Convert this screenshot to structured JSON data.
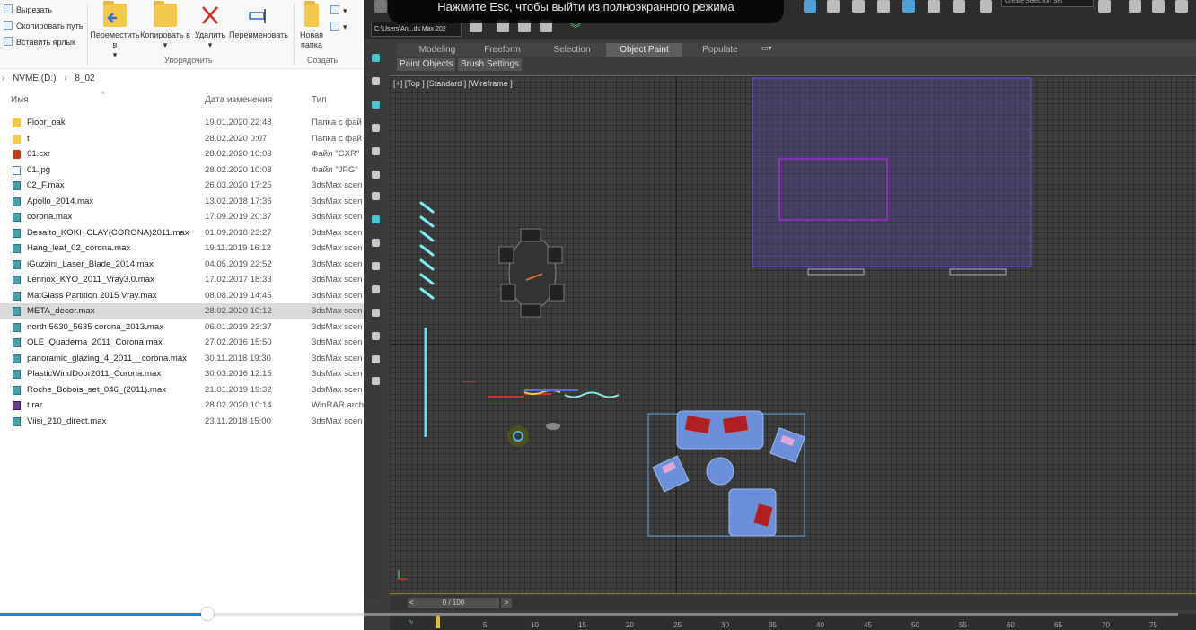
{
  "explorer": {
    "ribbon": {
      "cut": "Вырезать",
      "copy_path": "Скопировать путь",
      "paste_shortcut": "Вставить ярлык",
      "move_to": "Переместить в",
      "copy_to": "Копировать в",
      "delete": "Удалить",
      "rename": "Переименовать",
      "new_folder": "Новая папка",
      "group_organize": "Упорядочить",
      "group_create": "Создать",
      "dropdown_marker": "▾"
    },
    "address": {
      "drive": "NVME (D:)",
      "separator": "›",
      "folder": "8_02"
    },
    "columns": {
      "name": "Имя",
      "date": "Дата изменения",
      "type": "Тип"
    },
    "files": [
      {
        "name": "Floor_oak",
        "date": "19.01.2020 22:48",
        "type": "Папка с фай",
        "icon": "folder"
      },
      {
        "name": "t",
        "date": "28.02.2020 0:07",
        "type": "Папка с фай",
        "icon": "folder"
      },
      {
        "name": "01.cxr",
        "date": "28.02.2020 10:09",
        "type": "Файл \"CXR\"",
        "icon": "cxr"
      },
      {
        "name": "01.jpg",
        "date": "28.02.2020 10:08",
        "type": "Файл \"JPG\"",
        "icon": "jpg"
      },
      {
        "name": "02_F.max",
        "date": "26.03.2020 17:25",
        "type": "3dsMax scen",
        "icon": "max"
      },
      {
        "name": "Apollo_2014.max",
        "date": "13.02.2018 17:36",
        "type": "3dsMax scen",
        "icon": "max"
      },
      {
        "name": "corona.max",
        "date": "17.09.2019 20:37",
        "type": "3dsMax scen",
        "icon": "max"
      },
      {
        "name": "Desalto_KOKI+CLAY(CORONA)2011.max",
        "date": "01.09.2018 23:27",
        "type": "3dsMax scen",
        "icon": "max"
      },
      {
        "name": "Hang_leaf_02_corona.max",
        "date": "19.11.2019 16:12",
        "type": "3dsMax scen",
        "icon": "max"
      },
      {
        "name": "iGuzzini_Laser_Blade_2014.max",
        "date": "04.05.2019 22:52",
        "type": "3dsMax scen",
        "icon": "max"
      },
      {
        "name": "Lennox_KYO_2011_Vray3.0.max",
        "date": "17.02.2017 18:33",
        "type": "3dsMax scen",
        "icon": "max"
      },
      {
        "name": "MatGlass Partition 2015 Vray.max",
        "date": "08.08.2019 14:45",
        "type": "3dsMax scen",
        "icon": "max"
      },
      {
        "name": "META_decor.max",
        "date": "28.02.2020 10:12",
        "type": "3dsMax scen",
        "icon": "max",
        "selected": true
      },
      {
        "name": "north 5630_5635 corona_2013.max",
        "date": "06.01.2019 23:37",
        "type": "3dsMax scen",
        "icon": "max"
      },
      {
        "name": "OLE_Quaderna_2011_Corona.max",
        "date": "27.02.2016 15:50",
        "type": "3dsMax scen",
        "icon": "max"
      },
      {
        "name": "panoramic_glazing_4_2011__corona.max",
        "date": "30.11.2018 19:30",
        "type": "3dsMax scen",
        "icon": "max"
      },
      {
        "name": "PlasticWindDoor2011_Corona.max",
        "date": "30.03.2016 12:15",
        "type": "3dsMax scen",
        "icon": "max"
      },
      {
        "name": "Roche_Bobois_set_046_(2011).max",
        "date": "21.01.2019 19:32",
        "type": "3dsMax scen",
        "icon": "max"
      },
      {
        "name": "t.rar",
        "date": "28.02.2020 10:14",
        "type": "WinRAR arch",
        "icon": "rar"
      },
      {
        "name": "Viisi_210_direct.max",
        "date": "23.11.2018 15:00",
        "type": "3dsMax scen",
        "icon": "max"
      }
    ]
  },
  "max": {
    "esc_banner": "Нажмите Esc, чтобы выйти из полноэкранного режима",
    "project_path": "C:\\Users\\An...ds Max 202",
    "selection_set": "Create Selection Set",
    "tabs": [
      "Modeling",
      "Freeform",
      "Selection",
      "Object Paint",
      "Populate"
    ],
    "active_tab": "Object Paint",
    "subtabs": [
      "Paint Objects",
      "Brush Settings"
    ],
    "viewport_label": "[+] [Top ] [Standard ] [Wireframe ]",
    "frame_counter": "0 / 100",
    "timeline_prev": "<",
    "timeline_next": ">",
    "ruler_ticks": [
      "5",
      "10",
      "15",
      "20",
      "25",
      "30",
      "35",
      "40",
      "45",
      "50",
      "55",
      "60",
      "65",
      "70",
      "75"
    ]
  },
  "video": {
    "progress": 0.176
  },
  "colors": {
    "accent": "#1e88e5",
    "selection_grid": "#4a3f86"
  }
}
